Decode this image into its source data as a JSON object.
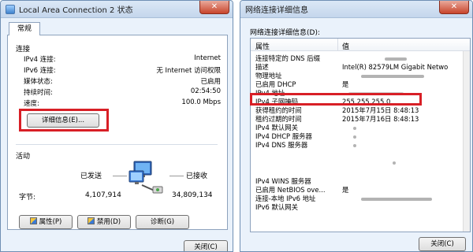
{
  "left_window": {
    "title": "Local Area Connection 2 状态",
    "close_label": "✕",
    "tab_label": "常规",
    "connection_group": "连接",
    "rows": [
      {
        "key": "IPv4 连接:",
        "value": "Internet"
      },
      {
        "key": "IPv6 连接:",
        "value": "无 Internet 访问权限"
      },
      {
        "key": "媒体状态:",
        "value": "已启用"
      },
      {
        "key": "持续时间:",
        "value": "02:54:50"
      },
      {
        "key": "速度:",
        "value": "100.0 Mbps"
      }
    ],
    "details_button": "详细信息(E)...",
    "activity_group": "活动",
    "sent_label": "已发送",
    "received_label": "已接收",
    "bytes_label": "字节:",
    "bytes_sent": "4,107,914",
    "bytes_received": "34,809,134",
    "properties_button": "属性(P)",
    "disable_button": "禁用(D)",
    "diagnose_button": "诊断(G)",
    "close_button": "关闭(C)"
  },
  "right_window": {
    "title": "网络连接详细信息",
    "close_label": "✕",
    "section_label": "网络连接详细信息(D):",
    "header_property": "属性",
    "header_value": "值",
    "rows": [
      {
        "property": "连接特定的 DNS 后缀",
        "value": ""
      },
      {
        "property": "描述",
        "value": "Intel(R) 82579LM Gigabit Netwo"
      },
      {
        "property": "物理地址",
        "value": ""
      },
      {
        "property": "已启用 DHCP",
        "value": "是"
      },
      {
        "property": "IPv4 地址",
        "value": ""
      },
      {
        "property": "IPv4 子网掩码",
        "value": "255.255.255.0"
      },
      {
        "property": "获得租约的时间",
        "value": "2015年7月15日 8:48:13"
      },
      {
        "property": "租约过期的时间",
        "value": "2015年7月16日 8:48:13"
      },
      {
        "property": "IPv4 默认网关",
        "value": ""
      },
      {
        "property": "IPv4 DHCP 服务器",
        "value": ""
      },
      {
        "property": "IPv4 DNS 服务器",
        "value": ""
      },
      {
        "property": "",
        "value": ""
      },
      {
        "property": "",
        "value": ""
      },
      {
        "property": "IPv4 WINS 服务器",
        "value": ""
      },
      {
        "property": "已启用 NetBIOS ove...",
        "value": "是"
      },
      {
        "property": "连接-本地 IPv6 地址",
        "value": ""
      },
      {
        "property": "IPv6 默认网关",
        "value": ""
      }
    ],
    "close_button": "关闭(C)"
  },
  "colors": {
    "highlight_box": "#d81f26",
    "window_frame": "#6f8fb3",
    "close_button": "#c8452c"
  },
  "icons": [
    "network-adapter-icon",
    "computers-network-icon",
    "shield-icon"
  ]
}
